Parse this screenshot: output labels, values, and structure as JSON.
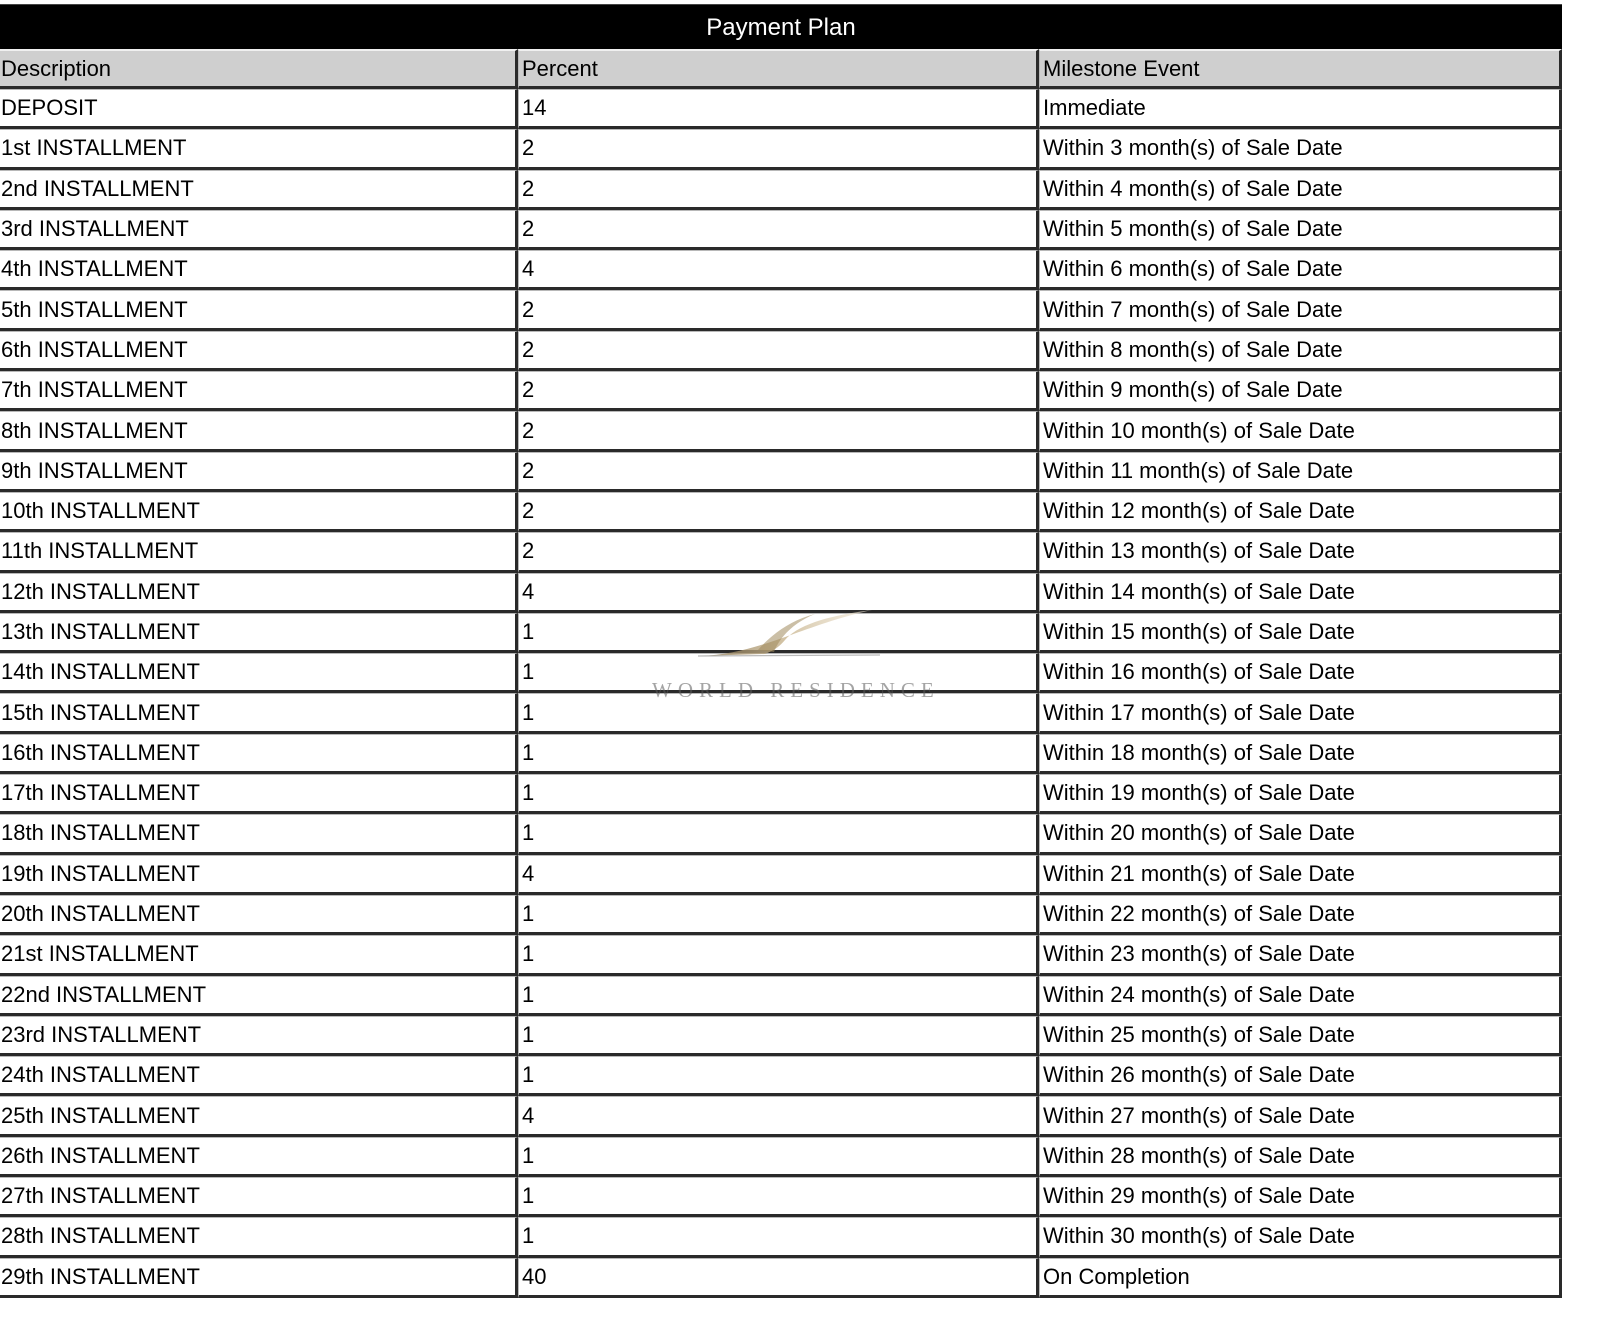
{
  "title": "Payment Plan",
  "columns": [
    "Description",
    "Percent",
    "Milestone Event"
  ],
  "rows": [
    [
      "DEPOSIT",
      "14",
      "Immediate"
    ],
    [
      "1st INSTALLMENT",
      "2",
      "Within 3 month(s) of Sale Date"
    ],
    [
      "2nd INSTALLMENT",
      "2",
      "Within 4 month(s) of Sale Date"
    ],
    [
      "3rd INSTALLMENT",
      "2",
      "Within 5 month(s) of Sale Date"
    ],
    [
      "4th INSTALLMENT",
      "4",
      "Within 6 month(s) of Sale Date"
    ],
    [
      "5th INSTALLMENT",
      "2",
      "Within 7 month(s) of Sale Date"
    ],
    [
      "6th INSTALLMENT",
      "2",
      "Within 8 month(s) of Sale Date"
    ],
    [
      "7th INSTALLMENT",
      "2",
      "Within 9 month(s) of Sale Date"
    ],
    [
      "8th INSTALLMENT",
      "2",
      "Within 10 month(s) of Sale Date"
    ],
    [
      "9th INSTALLMENT",
      "2",
      "Within 11 month(s) of Sale Date"
    ],
    [
      "10th INSTALLMENT",
      "2",
      "Within 12 month(s) of Sale Date"
    ],
    [
      "11th INSTALLMENT",
      "2",
      "Within 13 month(s) of Sale Date"
    ],
    [
      "12th INSTALLMENT",
      "4",
      "Within 14 month(s) of Sale Date"
    ],
    [
      "13th INSTALLMENT",
      "1",
      "Within 15 month(s) of Sale Date"
    ],
    [
      "14th INSTALLMENT",
      "1",
      "Within 16 month(s) of Sale Date"
    ],
    [
      "15th INSTALLMENT",
      "1",
      "Within 17 month(s) of Sale Date"
    ],
    [
      "16th INSTALLMENT",
      "1",
      "Within 18 month(s) of Sale Date"
    ],
    [
      "17th INSTALLMENT",
      "1",
      "Within 19 month(s) of Sale Date"
    ],
    [
      "18th INSTALLMENT",
      "1",
      "Within 20 month(s) of Sale Date"
    ],
    [
      "19th INSTALLMENT",
      "4",
      "Within 21 month(s) of Sale Date"
    ],
    [
      "20th INSTALLMENT",
      "1",
      "Within 22 month(s) of Sale Date"
    ],
    [
      "21st INSTALLMENT",
      "1",
      "Within 23 month(s) of Sale Date"
    ],
    [
      "22nd INSTALLMENT",
      "1",
      "Within 24 month(s) of Sale Date"
    ],
    [
      "23rd INSTALLMENT",
      "1",
      "Within 25 month(s) of Sale Date"
    ],
    [
      "24th INSTALLMENT",
      "1",
      "Within 26 month(s) of Sale Date"
    ],
    [
      "25th INSTALLMENT",
      "4",
      "Within 27 month(s) of Sale Date"
    ],
    [
      "26th INSTALLMENT",
      "1",
      "Within 28 month(s) of Sale Date"
    ],
    [
      "27th INSTALLMENT",
      "1",
      "Within 29 month(s) of Sale Date"
    ],
    [
      "28th INSTALLMENT",
      "1",
      "Within 30 month(s) of Sale Date"
    ],
    [
      "29th INSTALLMENT",
      "40",
      "On Completion"
    ]
  ],
  "watermark": {
    "text": "WORLD RESIDENCE",
    "accent_color": "#b9a27a"
  }
}
